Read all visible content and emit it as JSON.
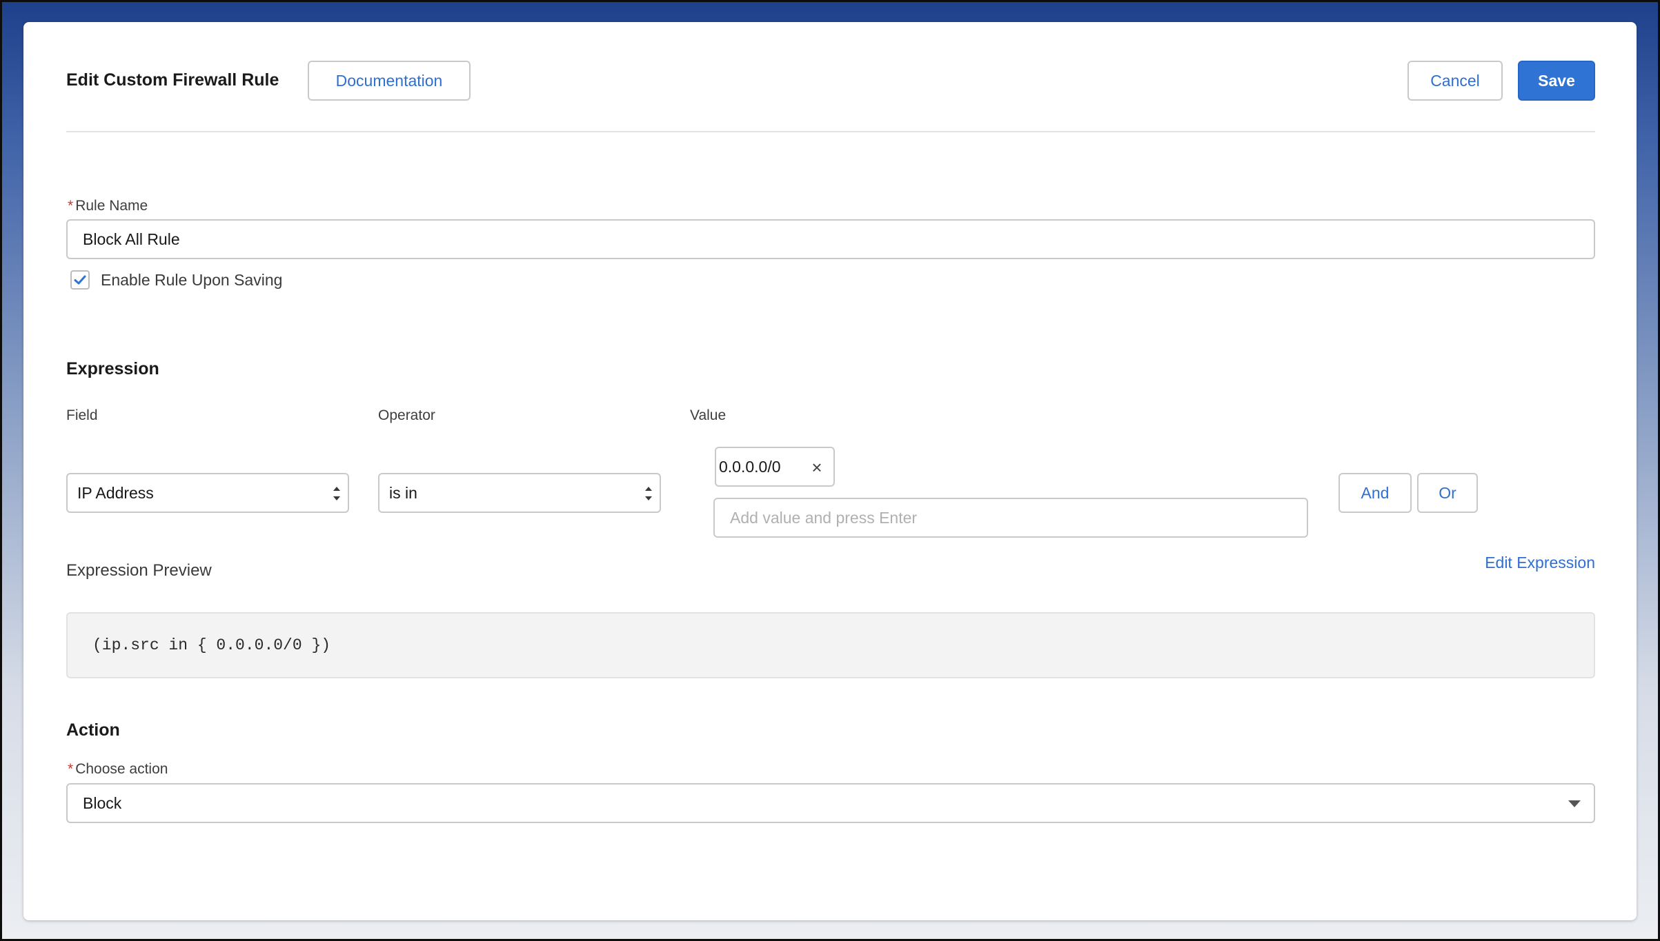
{
  "header": {
    "title": "Edit Custom Firewall Rule",
    "documentation_label": "Documentation",
    "cancel_label": "Cancel",
    "save_label": "Save"
  },
  "rule_name": {
    "required_marker": "*",
    "label": "Rule Name",
    "value": "Block All Rule"
  },
  "enable_on_save": {
    "label": "Enable Rule Upon Saving",
    "checked": true
  },
  "expression": {
    "heading": "Expression",
    "field_label": "Field",
    "operator_label": "Operator",
    "value_label": "Value",
    "field_value": "IP Address",
    "operator_value": "is in",
    "value_tags": [
      "0.0.0.0/0"
    ],
    "value_placeholder": "Add value and press Enter",
    "and_label": "And",
    "or_label": "Or",
    "preview_label": "Expression Preview",
    "edit_link": "Edit Expression",
    "preview_code": "(ip.src in { 0.0.0.0/0 })"
  },
  "action": {
    "heading": "Action",
    "required_marker": "*",
    "label": "Choose action",
    "value": "Block"
  },
  "colors": {
    "accent": "#2f73d4",
    "link": "#2e6fd0",
    "required": "#c23934"
  }
}
